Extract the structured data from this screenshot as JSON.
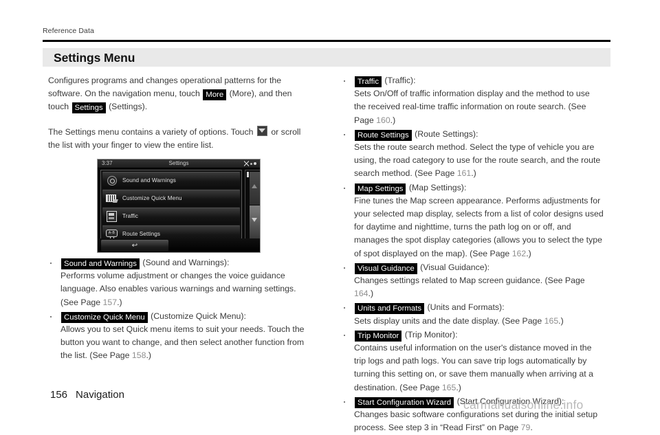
{
  "running_head": "Reference Data",
  "section": {
    "title": "Settings Menu"
  },
  "intro": {
    "p1_a": "Configures programs and changes operational patterns for the software. On the navigation menu, touch ",
    "p1_key_more": "More",
    "p1_b": " (More), and then touch ",
    "p1_key_settings": "Settings",
    "p1_c": " (Settings).",
    "p2_a": "The Settings menu contains a variety of options. Touch ",
    "p2_b": " or scroll the list with your finger to view the entire list."
  },
  "device": {
    "clock": "3:37",
    "title": "Settings",
    "status_icons": [
      "satellite-icon",
      "signal-dot",
      "signal-dot"
    ],
    "rows": [
      {
        "icon": "speaker-icon",
        "label": "Sound and Warnings"
      },
      {
        "icon": "grid-icon",
        "label": "Customize Quick Menu"
      },
      {
        "icon": "traffic-icon",
        "label": "Traffic"
      },
      {
        "icon": "route-icon",
        "label": "Route Settings"
      }
    ],
    "scroll_up_icon": "triangle-up-icon",
    "scroll_down_icon": "triangle-down-icon",
    "back_button_icon": "back-arrow-icon",
    "back_button_glyph": "↩"
  },
  "left_items": [
    {
      "key": "Sound and Warnings",
      "paren": " (Sound and Warnings):",
      "desc_a": "Performs volume adjustment or changes the voice guidance language. Also enables various warnings and warning settings. (See Page ",
      "page": "157",
      "desc_b": ".)"
    },
    {
      "key": "Customize Quick Menu",
      "paren": " (Customize Quick Menu):",
      "desc_a": "Allows you to set Quick menu items to suit your needs. Touch the button you want to change, and then select another function from the list. (See Page ",
      "page": "158",
      "desc_b": ".)"
    }
  ],
  "right_items": [
    {
      "key": "Traffic",
      "paren": " (Traffic):",
      "desc_a": "Sets On/Off of traffic information display and the method to use the received real-time traffic information on route search. (See Page ",
      "page": "160",
      "desc_b": ".)"
    },
    {
      "key": "Route Settings",
      "paren": " (Route Settings):",
      "desc_a": "Sets the route search method. Select the type of vehicle you are using, the road category to use for the route search, and the route search method. (See Page ",
      "page": "161",
      "desc_b": ".)"
    },
    {
      "key": "Map Settings",
      "paren": " (Map Settings):",
      "desc_a": "Fine tunes the Map screen appearance. Performs adjustments for your selected map display, selects from a list of color designs used for daytime and nighttime, turns the path log on or off, and manages the spot display categories (allows you to select the type of spot displayed on the map). (See Page ",
      "page": "162",
      "desc_b": ".)"
    },
    {
      "key": "Visual Guidance",
      "paren": " (Visual Guidance):",
      "desc_a": "Changes settings related to Map screen guidance. (See Page ",
      "page": "164",
      "desc_b": ".)"
    },
    {
      "key": "Units and Formats",
      "paren": " (Units and Formats):",
      "desc_a": "Sets display units and the date display. (See Page ",
      "page": "165",
      "desc_b": ".)"
    },
    {
      "key": "Trip Monitor",
      "paren": " (Trip Monitor):",
      "desc_a": "Contains useful information on the user's distance moved in the trip logs and path logs. You can save trip logs automatically by turning this setting on, or save them manually when arriving at a destination. (See Page ",
      "page": "165",
      "desc_b": ".)"
    },
    {
      "key": "Start Configuration Wizard",
      "paren": " (Start Configuration Wizard):",
      "desc_a": "Changes basic software configurations set during the initial setup process. See step 3 in “Read First” on Page ",
      "page": "79",
      "desc_b": "."
    }
  ],
  "footer": {
    "page_number": "156",
    "section_name": "Navigation",
    "watermark": "carmanualsonline.info"
  }
}
